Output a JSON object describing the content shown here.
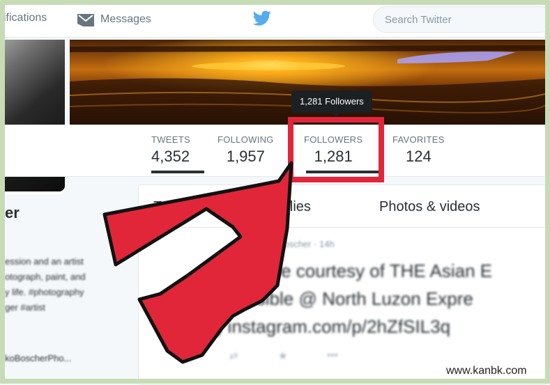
{
  "topbar": {
    "notifications_label": "ifications",
    "messages_label": "Messages",
    "search_placeholder": "Search Twitter"
  },
  "stats": {
    "tweets": {
      "label": "TWEETS",
      "value": "4,352"
    },
    "following": {
      "label": "FOLLOWING",
      "value": "1,957"
    },
    "followers": {
      "label": "FOLLOWERS",
      "value": "1,281"
    },
    "favorites": {
      "label": "FAVORITES",
      "value": "124"
    }
  },
  "tooltip": "1,281 Followers",
  "profile": {
    "name": "er",
    "bio_lines": [
      "ession and an artist",
      "otograph, paint, and",
      "y life. #photography",
      "ger #artist"
    ],
    "handle_link": "koBoscherPho..."
  },
  "timeline": {
    "tabs": [
      "Tw",
      "ts & replies",
      "Photos & videos"
    ],
    "tweet": {
      "meta": "@jorrkoscher · 14h",
      "lines": [
        "ome courtesy of THE Asian E",
        "visible @ North Luzon Expre",
        "(LEX) instagram.com/p/2hZfSIL3q"
      ],
      "actions": [
        "reply",
        "retweet",
        "favorite",
        "more"
      ]
    }
  },
  "watermark": "www.kanbk.com",
  "colors": {
    "highlight": "#e2263a",
    "arrow": "#e2263a",
    "twitter_blue": "#55acee"
  }
}
